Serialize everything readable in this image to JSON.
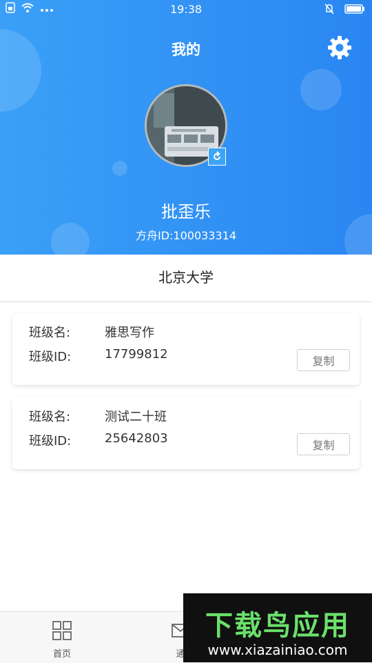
{
  "status_bar": {
    "time": "19:38",
    "left_icons": [
      "sim-icon",
      "wifi-icon",
      "more-dots-icon"
    ],
    "right_icons": [
      "mute-bell-icon",
      "battery-icon"
    ]
  },
  "header": {
    "title": "我的",
    "settings_icon": "gear-icon"
  },
  "profile": {
    "name": "批歪乐",
    "id_label": "方舟ID:100033314"
  },
  "school": {
    "name": "北京大学"
  },
  "classes": [
    {
      "name_label": "班级名:",
      "name": "雅思写作",
      "id_label": "班级ID:",
      "id": "17799812",
      "copy_label": "复制"
    },
    {
      "name_label": "班级名:",
      "name": "测试二十班",
      "id_label": "班级ID:",
      "id": "25642803",
      "copy_label": "复制"
    }
  ],
  "tabbar": {
    "items": [
      {
        "label": "首页",
        "icon": "grid-icon"
      },
      {
        "label": "通",
        "icon": "message-icon"
      }
    ]
  },
  "watermark": {
    "title": "下载鸟应用",
    "url": "www.xiazainiao.com"
  },
  "colors": {
    "header_start": "#3aa0f7",
    "header_end": "#2a86f2",
    "badge": "#3da5f5"
  }
}
